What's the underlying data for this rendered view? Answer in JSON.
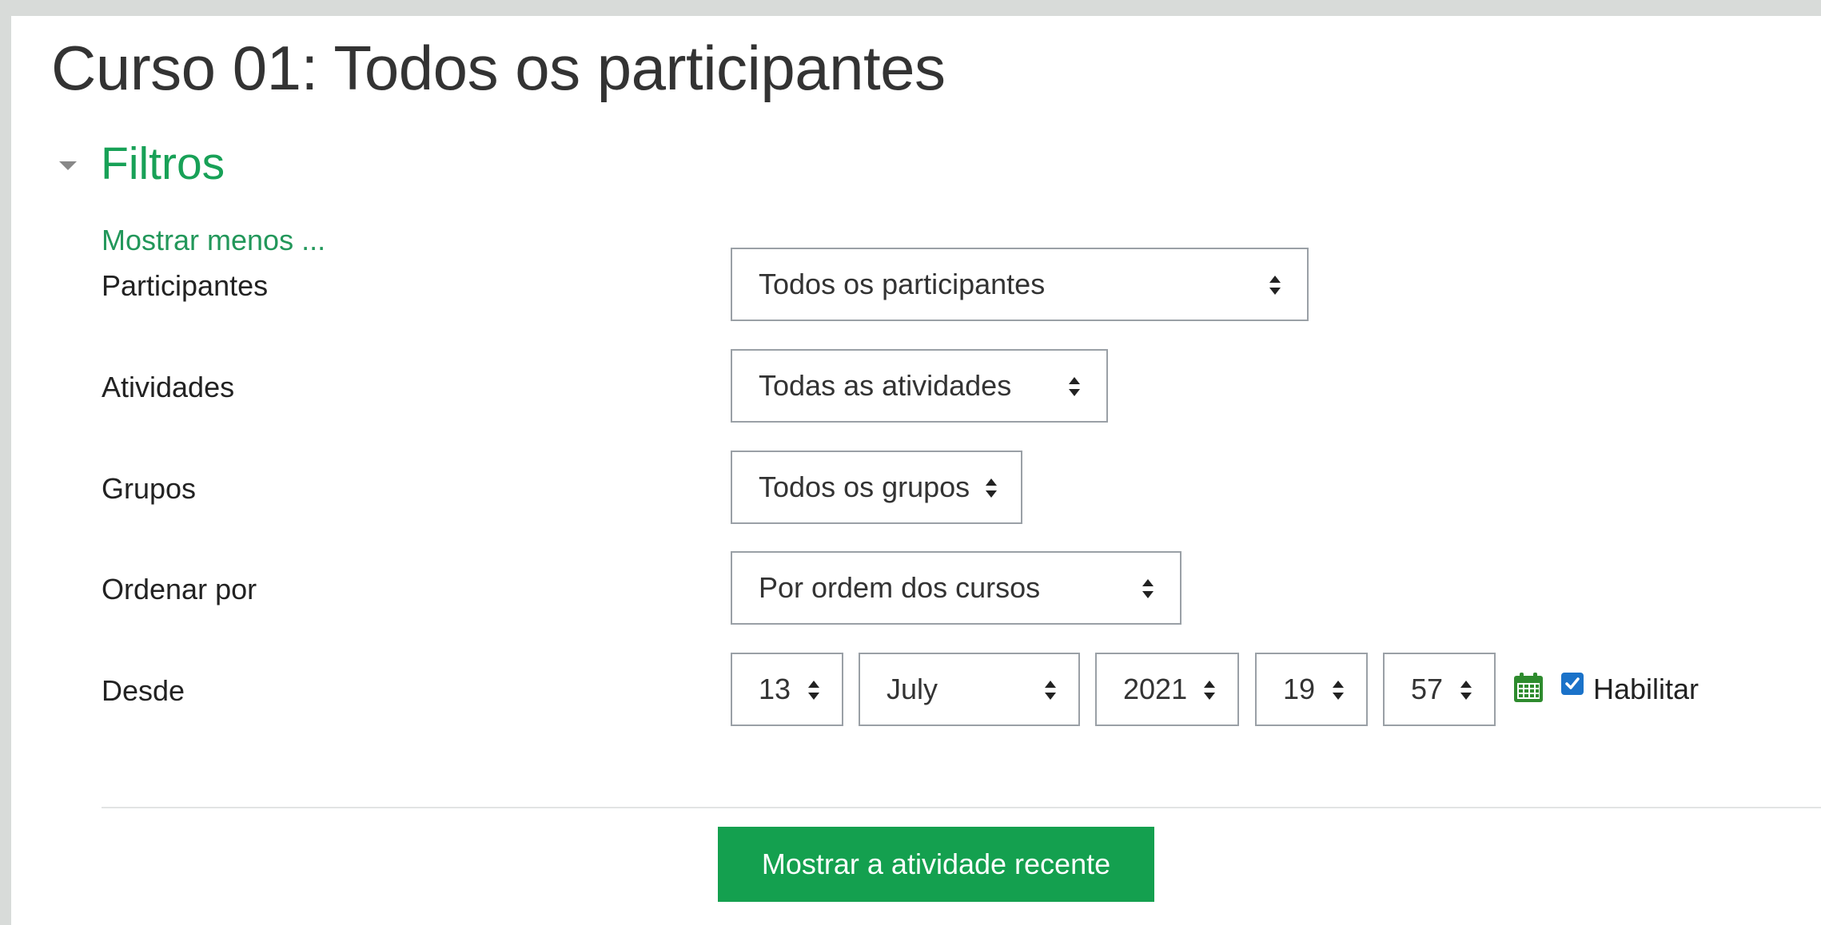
{
  "page": {
    "title": "Curso 01: Todos os participantes"
  },
  "filters": {
    "header": "Filtros",
    "show_less": "Mostrar menos ...",
    "participants": {
      "label": "Participantes",
      "value": "Todos os participantes"
    },
    "activities": {
      "label": "Atividades",
      "value": "Todas as atividades"
    },
    "groups": {
      "label": "Grupos",
      "value": "Todos os grupos"
    },
    "order_by": {
      "label": "Ordenar por",
      "value": "Por ordem dos cursos"
    },
    "since": {
      "label": "Desde",
      "day": "13",
      "month": "July",
      "year": "2021",
      "hour": "19",
      "minute": "57",
      "enable_label": "Habilitar",
      "enabled": true
    },
    "submit": "Mostrar a atividade recente"
  },
  "colors": {
    "accent_green": "#18a157",
    "button_green": "#14a04f",
    "checkbox_blue": "#1a72c9"
  },
  "icons": [
    "collapse-caret-icon",
    "calendar-icon",
    "checkbox-checked-icon",
    "select-arrows-icon"
  ]
}
